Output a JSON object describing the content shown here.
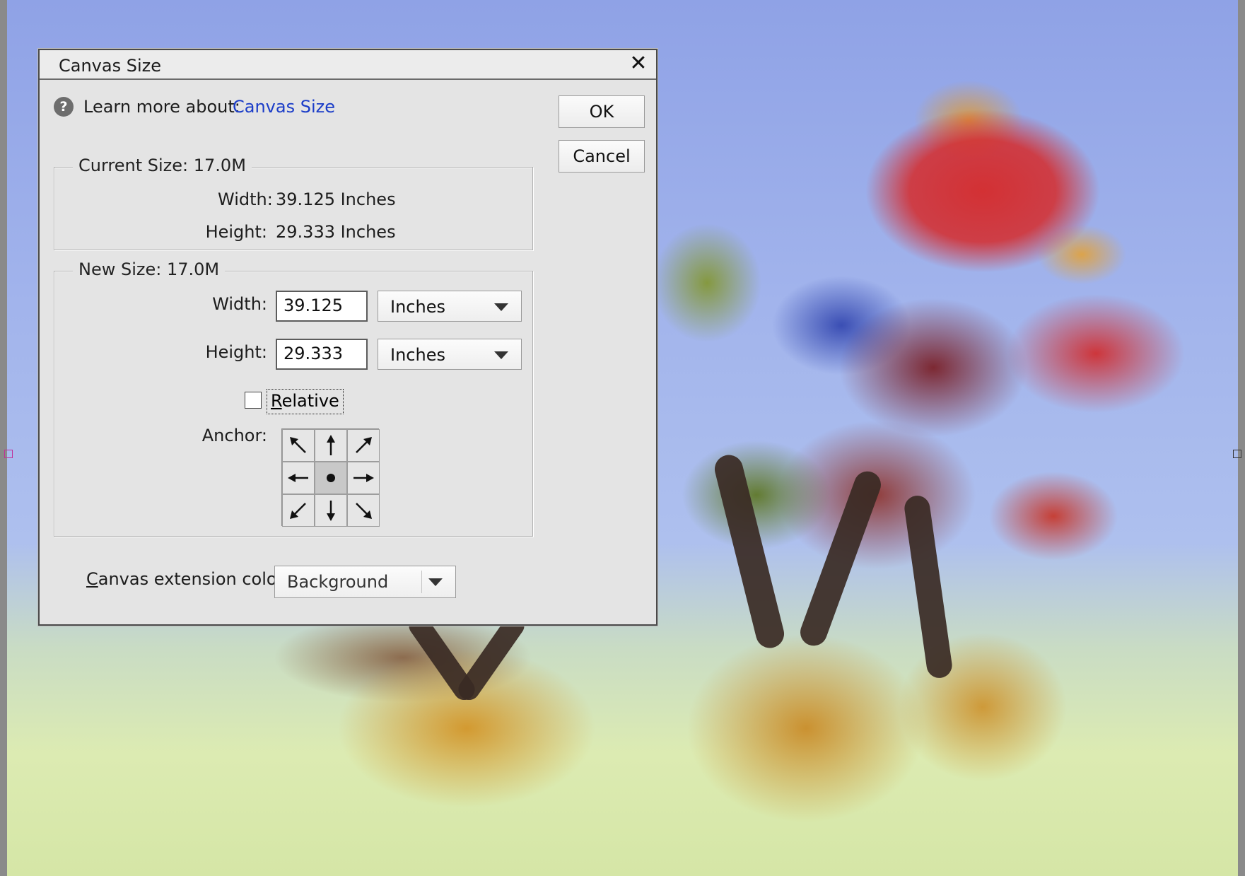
{
  "dialog": {
    "title": "Canvas Size",
    "close_glyph": "✕",
    "help_glyph": "?",
    "learn_more_label": "Learn more about:",
    "learn_more_link": "Canvas Size",
    "ok_label": "OK",
    "cancel_label": "Cancel"
  },
  "current_size": {
    "title": "Current Size: 17.0M",
    "width_label": "Width:",
    "width_value": "39.125 Inches",
    "height_label": "Height:",
    "height_value": "29.333 Inches"
  },
  "new_size": {
    "title": "New Size: 17.0M",
    "width_label": "Width:",
    "width_value": "39.125",
    "width_unit": "Inches",
    "height_label": "Height:",
    "height_value": "29.333",
    "height_unit": "Inches",
    "relative_rest": "elative",
    "relative_mnemonic": "R",
    "relative_checked": false,
    "anchor_label": "Anchor:",
    "anchor_selected": "center"
  },
  "extension": {
    "label_mnemonic": "C",
    "label_rest": "anvas extension color:",
    "value": "Background"
  },
  "icons": [
    "close-icon",
    "help-icon",
    "dropdown-arrow-icon",
    "arrow-up-left-icon",
    "arrow-up-icon",
    "arrow-up-right-icon",
    "arrow-left-icon",
    "center-dot-icon",
    "arrow-right-icon",
    "arrow-down-left-icon",
    "arrow-down-icon",
    "arrow-down-right-icon"
  ]
}
